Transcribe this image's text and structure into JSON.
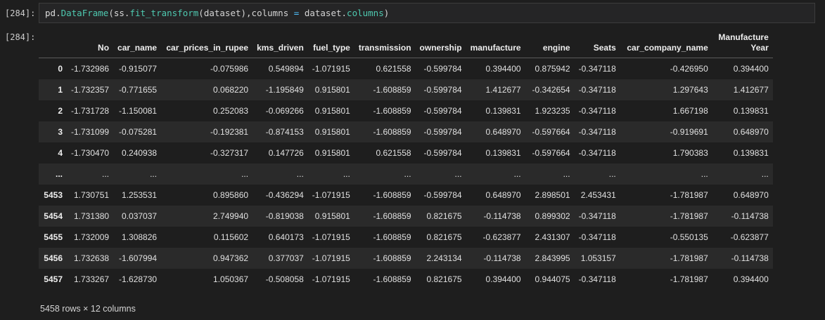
{
  "cell": {
    "in_prompt": "[284]:",
    "out_prompt": "[284]:",
    "code": {
      "pd": "pd",
      "dot1": ".",
      "DataFrame": "DataFrame",
      "p1": "(",
      "ss": "ss",
      "dot2": ".",
      "fit_transform": "fit_transform",
      "p2": "(dataset),columns ",
      "eq": "=",
      "p3": " dataset",
      "dot3": ".",
      "columns": "columns",
      "p4": ")"
    }
  },
  "table": {
    "columns": [
      "No",
      "car_name",
      "car_prices_in_rupee",
      "kms_driven",
      "fuel_type",
      "transmission",
      "ownership",
      "manufacture",
      "engine",
      "Seats",
      "car_company_name",
      "Manufacture Year"
    ],
    "rows": [
      {
        "index": "0",
        "cells": [
          "-1.732986",
          "-0.915077",
          "-0.075986",
          "0.549894",
          "-1.071915",
          "0.621558",
          "-0.599784",
          "0.394400",
          "0.875942",
          "-0.347118",
          "-0.426950",
          "0.394400"
        ]
      },
      {
        "index": "1",
        "cells": [
          "-1.732357",
          "-0.771655",
          "0.068220",
          "-1.195849",
          "0.915801",
          "-1.608859",
          "-0.599784",
          "1.412677",
          "-0.342654",
          "-0.347118",
          "1.297643",
          "1.412677"
        ]
      },
      {
        "index": "2",
        "cells": [
          "-1.731728",
          "-1.150081",
          "0.252083",
          "-0.069266",
          "0.915801",
          "-1.608859",
          "-0.599784",
          "0.139831",
          "1.923235",
          "-0.347118",
          "1.667198",
          "0.139831"
        ]
      },
      {
        "index": "3",
        "cells": [
          "-1.731099",
          "-0.075281",
          "-0.192381",
          "-0.874153",
          "0.915801",
          "-1.608859",
          "-0.599784",
          "0.648970",
          "-0.597664",
          "-0.347118",
          "-0.919691",
          "0.648970"
        ]
      },
      {
        "index": "4",
        "cells": [
          "-1.730470",
          "0.240938",
          "-0.327317",
          "0.147726",
          "0.915801",
          "0.621558",
          "-0.599784",
          "0.139831",
          "-0.597664",
          "-0.347118",
          "1.790383",
          "0.139831"
        ]
      },
      {
        "index": "...",
        "cells": [
          "...",
          "...",
          "...",
          "...",
          "...",
          "...",
          "...",
          "...",
          "...",
          "...",
          "...",
          "..."
        ]
      },
      {
        "index": "5453",
        "cells": [
          "1.730751",
          "1.253531",
          "0.895860",
          "-0.436294",
          "-1.071915",
          "-1.608859",
          "-0.599784",
          "0.648970",
          "2.898501",
          "2.453431",
          "-1.781987",
          "0.648970"
        ]
      },
      {
        "index": "5454",
        "cells": [
          "1.731380",
          "0.037037",
          "2.749940",
          "-0.819038",
          "0.915801",
          "-1.608859",
          "0.821675",
          "-0.114738",
          "0.899302",
          "-0.347118",
          "-1.781987",
          "-0.114738"
        ]
      },
      {
        "index": "5455",
        "cells": [
          "1.732009",
          "1.308826",
          "0.115602",
          "0.640173",
          "-1.071915",
          "-1.608859",
          "0.821675",
          "-0.623877",
          "2.431307",
          "-0.347118",
          "-0.550135",
          "-0.623877"
        ]
      },
      {
        "index": "5456",
        "cells": [
          "1.732638",
          "-1.607994",
          "0.947362",
          "0.377037",
          "-1.071915",
          "-1.608859",
          "2.243134",
          "-0.114738",
          "2.843995",
          "1.053157",
          "-1.781987",
          "-0.114738"
        ]
      },
      {
        "index": "5457",
        "cells": [
          "1.733267",
          "-1.628730",
          "1.050367",
          "-0.508058",
          "-1.071915",
          "-1.608859",
          "0.821675",
          "0.394400",
          "0.944075",
          "-0.347118",
          "-1.781987",
          "0.394400"
        ]
      }
    ],
    "summary": "5458 rows × 12 columns"
  }
}
